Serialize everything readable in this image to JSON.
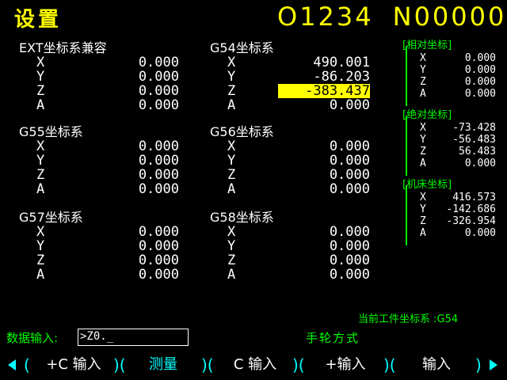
{
  "header": {
    "title": "设置",
    "program": "O1234",
    "sequence": "N00000"
  },
  "blocks": [
    {
      "name": "EXT坐标系兼容",
      "rows": [
        {
          "axis": "X",
          "value": "0.000"
        },
        {
          "axis": "Y",
          "value": "0.000"
        },
        {
          "axis": "Z",
          "value": "0.000"
        },
        {
          "axis": "A",
          "value": "0.000"
        }
      ]
    },
    {
      "name": "G54坐标系",
      "rows": [
        {
          "axis": "X",
          "value": "490.001"
        },
        {
          "axis": "Y",
          "value": "-86.203"
        },
        {
          "axis": "Z",
          "value": "-383.437"
        },
        {
          "axis": "A",
          "value": "0.000"
        }
      ]
    },
    {
      "name": "G55坐标系",
      "rows": [
        {
          "axis": "X",
          "value": "0.000"
        },
        {
          "axis": "Y",
          "value": "0.000"
        },
        {
          "axis": "Z",
          "value": "0.000"
        },
        {
          "axis": "A",
          "value": "0.000"
        }
      ]
    },
    {
      "name": "G56坐标系",
      "rows": [
        {
          "axis": "X",
          "value": "0.000"
        },
        {
          "axis": "Y",
          "value": "0.000"
        },
        {
          "axis": "Z",
          "value": "0.000"
        },
        {
          "axis": "A",
          "value": "0.000"
        }
      ]
    },
    {
      "name": "G57坐标系",
      "rows": [
        {
          "axis": "X",
          "value": "0.000"
        },
        {
          "axis": "Y",
          "value": "0.000"
        },
        {
          "axis": "Z",
          "value": "0.000"
        },
        {
          "axis": "A",
          "value": "0.000"
        }
      ]
    },
    {
      "name": "G58坐标系",
      "rows": [
        {
          "axis": "X",
          "value": "0.000"
        },
        {
          "axis": "Y",
          "value": "0.000"
        },
        {
          "axis": "Z",
          "value": "0.000"
        },
        {
          "axis": "A",
          "value": "0.000"
        }
      ]
    }
  ],
  "panels": [
    {
      "title": "[相对坐标]",
      "rows": [
        {
          "axis": "X",
          "value": "0.000"
        },
        {
          "axis": "Y",
          "value": "0.000"
        },
        {
          "axis": "Z",
          "value": "0.000"
        },
        {
          "axis": "A",
          "value": "0.000"
        }
      ]
    },
    {
      "title": "[绝对坐标]",
      "rows": [
        {
          "axis": "X",
          "value": "-73.428"
        },
        {
          "axis": "Y",
          "value": "-56.483"
        },
        {
          "axis": "Z",
          "value": "56.483"
        },
        {
          "axis": "A",
          "value": "0.000"
        }
      ]
    },
    {
      "title": "[机床坐标]",
      "rows": [
        {
          "axis": "X",
          "value": "416.573"
        },
        {
          "axis": "Y",
          "value": "-142.686"
        },
        {
          "axis": "Z",
          "value": "-326.954"
        },
        {
          "axis": "A",
          "value": "0.000"
        }
      ]
    }
  ],
  "current_wcs": "当前工件坐标系 :G54",
  "input": {
    "label": "数据输入:",
    "value": ">Z0._"
  },
  "mode": "手轮方式",
  "softkeys": [
    "+C 输入",
    "测量",
    "C 输入",
    "+输入",
    "输入"
  ],
  "colors": {
    "accent_yellow": "#ffff00",
    "label_green": "#00ff00",
    "bracket_cyan": "#00ffff"
  }
}
